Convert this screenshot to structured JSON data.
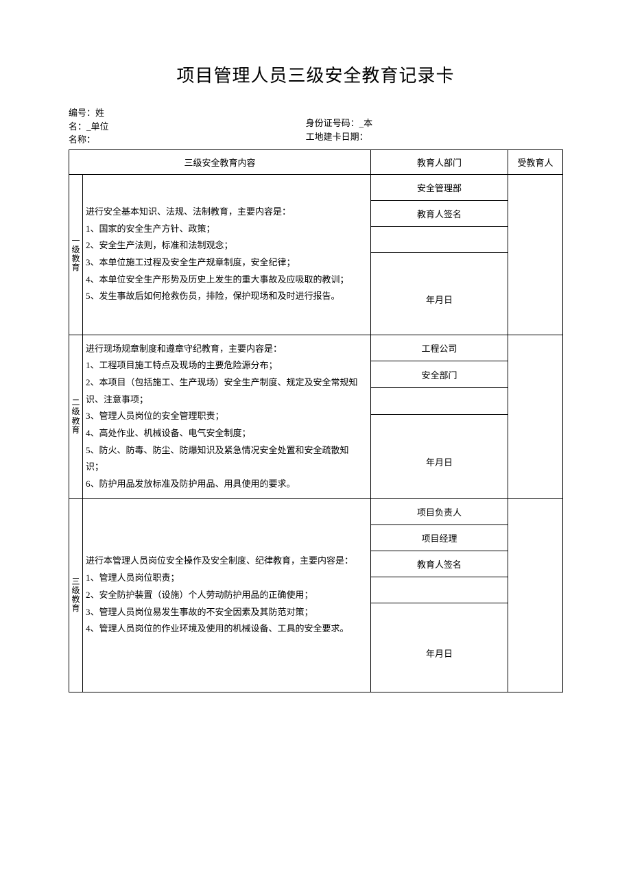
{
  "title": "项目管理人员三级安全教育记录卡",
  "meta": {
    "left_line1": "编号：姓",
    "left_line2": "名：_单位",
    "left_line3": "名称：",
    "right_line1": "身份证号码：_本",
    "right_line2": "工地建卡日期："
  },
  "header": {
    "content": "三级安全教育内容",
    "dept": "教育人部门",
    "person": "受教育人"
  },
  "level1": {
    "label": "一级教育",
    "content": "进行安全基本知识、法规、法制教育，主要内容是：\n1、国家的安全生产方针、政策；\n2、安全生产法则，标准和法制观念；\n3、本单位施工过程及安全生产规章制度，安全纪律；\n4、本单位安全生产形势及历史上发生的重大事故及应吸取的教训；\n5、发生事故后如何抢救伤员，排险，保护现场和及时进行报告。",
    "rows": [
      "安全管理部",
      "教育人签名",
      ""
    ],
    "date": "年月日"
  },
  "level2": {
    "label": "二级教育",
    "content": "进行现场规章制度和遵章守纪教育，主要内容是：\n1、工程项目施工特点及现场的主要危险源分布；\n2、本项目（包括施工、生产现场）安全生产制度、规定及安全常规知识、注意事项；\n3、管理人员岗位的安全管理职责；\n4、高处作业、机械设备、电气安全制度；\n5、防火、防毒、防尘、防爆知识及紧急情况安全处置和安全疏散知识；\n6、防护用品发放标准及防护用品、用具使用的要求。",
    "rows": [
      "工程公司",
      "安全部门",
      ""
    ],
    "date": "年月日"
  },
  "level3": {
    "label": "三级教育",
    "content": "进行本管理人员岗位安全操作及安全制度、纪律教育，主要内容是：\n1、管理人员岗位职责；\n2、安全防护装置（设施）个人劳动防护用品的正确使用；\n3、管理人员岗位易发生事故的不安全因素及其防范对策；\n4、管理人员岗位的作业环境及使用的机械设备、工具的安全要求。",
    "rows": [
      "项目负责人",
      "项目经理",
      "教育人签名",
      ""
    ],
    "date": "年月日"
  }
}
